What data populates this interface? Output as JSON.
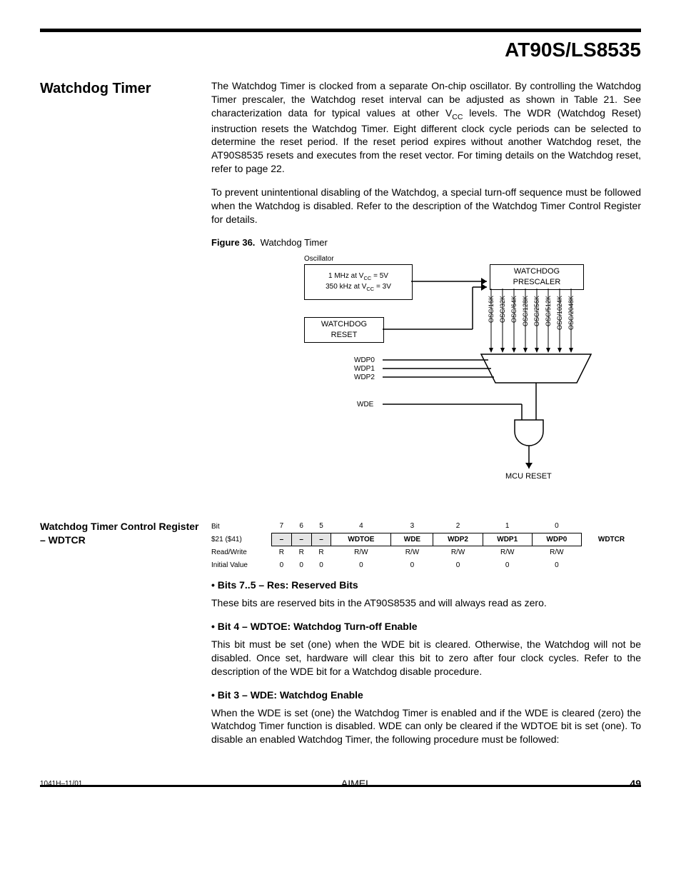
{
  "doc_title": "AT90S/LS8535",
  "section_title": "Watchdog Timer",
  "para1_html": "The Watchdog Timer is clocked from a separate On-chip oscillator. By controlling the Watchdog Timer prescaler, the Watchdog reset interval can be adjusted as shown in Table 21. See characterization data for typical values at other V<span class=\"sub\">CC</span> levels. The WDR (Watchdog Reset) instruction resets the Watchdog Timer. Eight different clock cycle periods can be selected to determine the reset period. If the reset period expires without another Watchdog reset, the AT90S8535 resets and executes from the reset vector. For timing details on the Watchdog reset, refer to page 22.",
  "para2": "To prevent unintentional disabling of the Watchdog, a special turn-off sequence must be followed when the Watchdog is disabled. Refer to the description of the Watchdog Timer Control Register for details.",
  "figure_label": "Figure 36.",
  "figure_title": "Watchdog Timer",
  "diagram": {
    "osc_label": "Oscillator",
    "osc_line1_html": "1 MHz at V<span class=\"sub\">CC</span> = 5V",
    "osc_line2_html": "350 kHz at V<span class=\"sub\">CC</span> = 3V",
    "watchdog_reset": "WATCHDOG\nRESET",
    "prescaler": "WATCHDOG\nPRESCALER",
    "taps": [
      "OSC/16K",
      "OSC/32K",
      "OSC/64K",
      "OSC/128K",
      "OSC/256K",
      "OSC/512K",
      "OSC/1024K",
      "OSC/2048K"
    ],
    "sel_inputs": [
      "WDP0",
      "WDP1",
      "WDP2"
    ],
    "enable_input": "WDE",
    "mcu_reset": "MCU RESET"
  },
  "subsection_title": "Watchdog Timer Control Register – WDTCR",
  "register": {
    "addr": "$21 ($41)",
    "name": "WDTCR",
    "bit_row_label": "Bit",
    "rw_row_label": "Read/Write",
    "iv_row_label": "Initial Value",
    "bits": [
      "7",
      "6",
      "5",
      "4",
      "3",
      "2",
      "1",
      "0"
    ],
    "names": [
      "–",
      "–",
      "–",
      "WDTOE",
      "WDE",
      "WDP2",
      "WDP1",
      "WDP0"
    ],
    "rw": [
      "R",
      "R",
      "R",
      "R/W",
      "R/W",
      "R/W",
      "R/W",
      "R/W"
    ],
    "initial": [
      "0",
      "0",
      "0",
      "0",
      "0",
      "0",
      "0",
      "0"
    ]
  },
  "bullets": [
    {
      "heading": "Bits 7..5 – Res: Reserved Bits",
      "body": "These bits are reserved bits in the AT90S8535 and will always read as zero."
    },
    {
      "heading": "Bit 4 – WDTOE: Watchdog Turn-off Enable",
      "body": "This bit must be set (one) when the WDE bit is cleared. Otherwise, the Watchdog will not be disabled. Once set, hardware will clear this bit to zero after four clock cycles. Refer to the description of the WDE bit for a Watchdog disable procedure."
    },
    {
      "heading": "Bit 3 – WDE: Watchdog Enable",
      "body": "When the WDE is set (one) the Watchdog Timer is enabled and if the WDE is cleared (zero) the Watchdog Timer function is disabled. WDE can only be cleared if the WDTOE bit is set (one). To disable an enabled Watchdog Timer, the following procedure must be followed:"
    }
  ],
  "footer": {
    "docnum": "1041H–11/01",
    "logo": "AIMEL",
    "pagenum": "49"
  }
}
